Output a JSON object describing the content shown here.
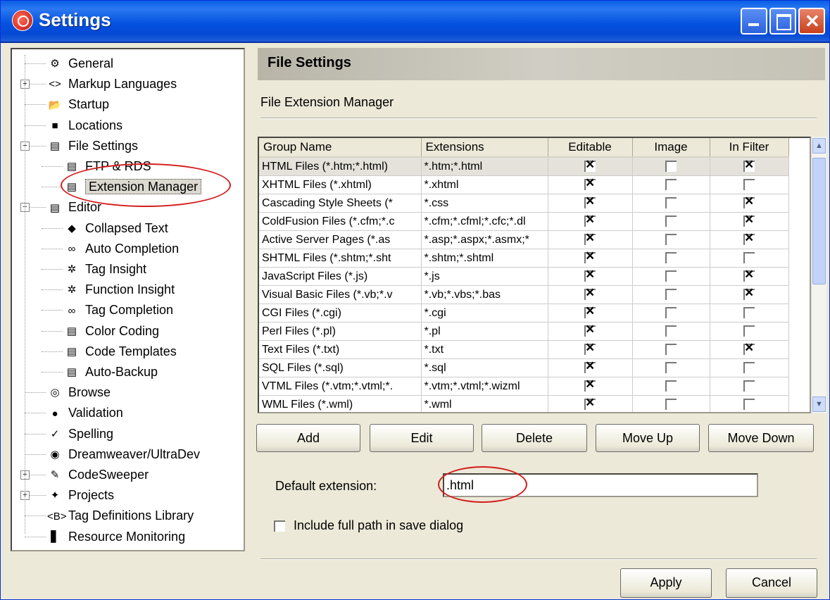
{
  "window": {
    "title": "Settings"
  },
  "tree": [
    {
      "label": "General",
      "icon": "gear-icon",
      "level": 0
    },
    {
      "label": "Markup Languages",
      "icon": "markup-icon",
      "level": 0,
      "expandable": true
    },
    {
      "label": "Startup",
      "icon": "folder-icon",
      "level": 0
    },
    {
      "label": "Locations",
      "icon": "disk-icon",
      "level": 0
    },
    {
      "label": "File Settings",
      "icon": "file-settings-icon",
      "level": 0,
      "expanded": true
    },
    {
      "label": "FTP & RDS",
      "icon": "ftp-icon",
      "level": 1
    },
    {
      "label": "Extension Manager",
      "icon": "extension-icon",
      "level": 1,
      "selected": true
    },
    {
      "label": "Editor",
      "icon": "editor-icon",
      "level": 0,
      "expanded": true
    },
    {
      "label": "Collapsed Text",
      "icon": "collapsed-text-icon",
      "level": 1
    },
    {
      "label": "Auto Completion",
      "icon": "binoculars-icon",
      "level": 1
    },
    {
      "label": "Tag Insight",
      "icon": "lightbulb-icon",
      "level": 1
    },
    {
      "label": "Function Insight",
      "icon": "lightbulb-icon",
      "level": 1
    },
    {
      "label": "Tag Completion",
      "icon": "binoculars-icon",
      "level": 1
    },
    {
      "label": "Color Coding",
      "icon": "document-icon",
      "level": 1
    },
    {
      "label": "Code Templates",
      "icon": "templates-icon",
      "level": 1
    },
    {
      "label": "Auto-Backup",
      "icon": "backup-icon",
      "level": 1
    },
    {
      "label": "Browse",
      "icon": "browse-icon",
      "level": 0
    },
    {
      "label": "Validation",
      "icon": "validation-icon",
      "level": 0
    },
    {
      "label": "Spelling",
      "icon": "spelling-icon",
      "level": 0
    },
    {
      "label": "Dreamweaver/UltraDev",
      "icon": "dreamweaver-icon",
      "level": 0
    },
    {
      "label": "CodeSweeper",
      "icon": "broom-icon",
      "level": 0,
      "expandable": true
    },
    {
      "label": "Projects",
      "icon": "projects-icon",
      "level": 0,
      "expandable": true
    },
    {
      "label": "Tag Definitions Library",
      "icon": "tag-library-icon",
      "level": 0
    },
    {
      "label": "Resource Monitoring",
      "icon": "chart-icon",
      "level": 0
    }
  ],
  "panel": {
    "heading": "File Settings",
    "section": "File Extension Manager"
  },
  "grid": {
    "columns": [
      "Group Name",
      "Extensions",
      "Editable",
      "Image",
      "In Filter"
    ],
    "rows": [
      {
        "name": "HTML Files (*.htm;*.html)",
        "ext": "*.htm;*.html",
        "editable": true,
        "image": false,
        "filter": true
      },
      {
        "name": "XHTML Files (*.xhtml)",
        "ext": "*.xhtml",
        "editable": true,
        "image": false,
        "filter": false
      },
      {
        "name": "Cascading Style Sheets (*",
        "ext": "*.css",
        "editable": true,
        "image": false,
        "filter": true
      },
      {
        "name": "ColdFusion Files (*.cfm;*.c",
        "ext": "*.cfm;*.cfml;*.cfc;*.dl",
        "editable": true,
        "image": false,
        "filter": true
      },
      {
        "name": "Active Server Pages (*.as",
        "ext": "*.asp;*.aspx;*.asmx;*",
        "editable": true,
        "image": false,
        "filter": true
      },
      {
        "name": "SHTML Files (*.shtm;*.sht",
        "ext": "*.shtm;*.shtml",
        "editable": true,
        "image": false,
        "filter": false
      },
      {
        "name": "JavaScript Files (*.js)",
        "ext": "*.js",
        "editable": true,
        "image": false,
        "filter": true
      },
      {
        "name": "Visual Basic Files (*.vb;*.v",
        "ext": "*.vb;*.vbs;*.bas",
        "editable": true,
        "image": false,
        "filter": true
      },
      {
        "name": "CGI Files (*.cgi)",
        "ext": "*.cgi",
        "editable": true,
        "image": false,
        "filter": false
      },
      {
        "name": "Perl Files (*.pl)",
        "ext": "*.pl",
        "editable": true,
        "image": false,
        "filter": false
      },
      {
        "name": "Text Files (*.txt)",
        "ext": "*.txt",
        "editable": true,
        "image": false,
        "filter": true
      },
      {
        "name": "SQL Files (*.sql)",
        "ext": "*.sql",
        "editable": true,
        "image": false,
        "filter": false
      },
      {
        "name": "VTML Files (*.vtm;*.vtml;*.",
        "ext": "*.vtm;*.vtml;*.wizml",
        "editable": true,
        "image": false,
        "filter": false
      },
      {
        "name": "WML Files (*.wml)",
        "ext": "*.wml",
        "editable": true,
        "image": false,
        "filter": false
      }
    ]
  },
  "buttons": {
    "add": "Add",
    "edit": "Edit",
    "delete": "Delete",
    "move_up": "Move Up",
    "move_down": "Move Down",
    "apply": "Apply",
    "cancel": "Cancel"
  },
  "default_extension": {
    "label": "Default extension:",
    "value": ".html"
  },
  "include_path": {
    "label": "Include full path in save dialog",
    "checked": false
  },
  "colors": {
    "title_bar": "#0553e1",
    "highlight_ring": "#d41c1c",
    "window_bg": "#ece9d8"
  }
}
